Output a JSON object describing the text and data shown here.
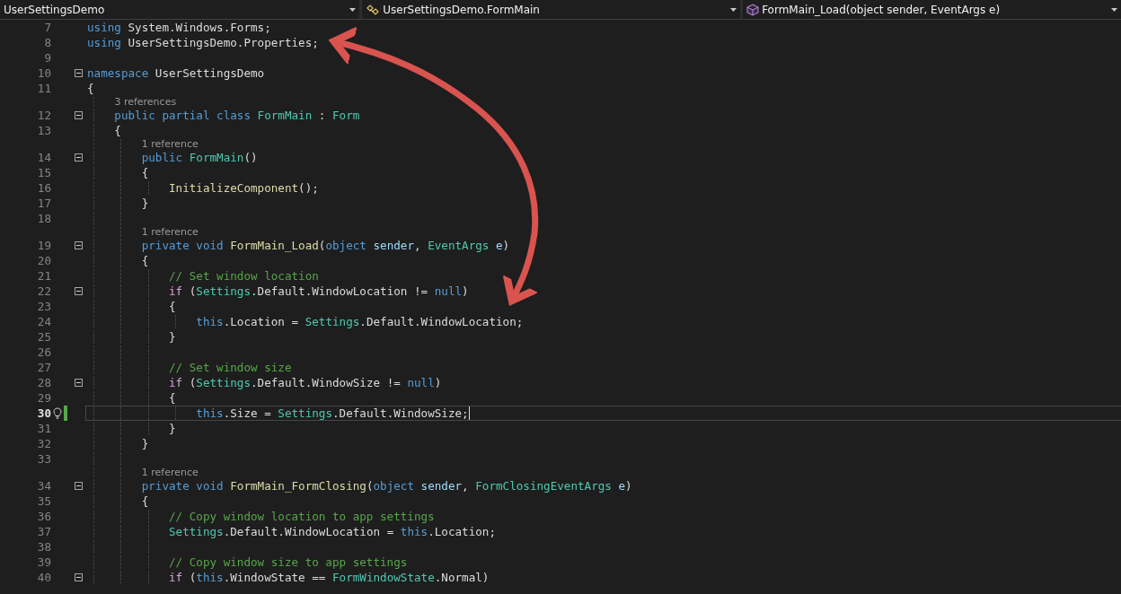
{
  "nav_bar": [
    {
      "label": "UserSettingsDemo",
      "kind": "project"
    },
    {
      "label": "UserSettingsDemo.FormMain",
      "kind": "class"
    },
    {
      "label": "FormMain_Load(object sender, EventArgs e)",
      "kind": "method"
    }
  ],
  "lines": [
    {
      "number": "7",
      "fold": false,
      "current": false,
      "tokens": [
        {
          "kind": "keyword",
          "text": "using"
        },
        {
          "kind": "plain",
          "text": " System.Windows.Forms;"
        }
      ]
    },
    {
      "number": "8",
      "fold": false,
      "current": false,
      "tokens": [
        {
          "kind": "keyword",
          "text": "using"
        },
        {
          "kind": "plain",
          "text": " UserSettingsDemo.Properties;"
        }
      ]
    },
    {
      "number": "9",
      "fold": false,
      "current": false
    },
    {
      "number": "10",
      "fold": true,
      "current": false,
      "tokens": [
        {
          "kind": "keyword",
          "text": "namespace"
        },
        {
          "kind": "plain",
          "text": " UserSettingsDemo"
        }
      ]
    },
    {
      "number": "11",
      "fold": false,
      "current": false,
      "tokens": [
        {
          "kind": "plain",
          "text": "{"
        }
      ]
    },
    {
      "number": "12",
      "fold": true,
      "current": false,
      "lens": "3 references",
      "tokens": [
        {
          "kind": "keyword",
          "text": "    public partial class "
        },
        {
          "kind": "type",
          "text": "FormMain"
        },
        {
          "kind": "plain",
          "text": " : "
        },
        {
          "kind": "type",
          "text": "Form"
        }
      ]
    },
    {
      "number": "13",
      "fold": false,
      "current": false,
      "tokens": [
        {
          "kind": "plain",
          "text": "    {"
        }
      ]
    },
    {
      "number": "14",
      "fold": true,
      "current": false,
      "lens": "1 reference",
      "tokens": [
        {
          "kind": "keyword",
          "text": "        public "
        },
        {
          "kind": "type",
          "text": "FormMain"
        },
        {
          "kind": "plain",
          "text": "()"
        }
      ]
    },
    {
      "number": "15",
      "fold": false,
      "current": false,
      "tokens": [
        {
          "kind": "plain",
          "text": "        {"
        }
      ]
    },
    {
      "number": "16",
      "fold": false,
      "current": false,
      "tokens": [
        {
          "kind": "method",
          "text": "            InitializeComponent"
        },
        {
          "kind": "plain",
          "text": "();"
        }
      ]
    },
    {
      "number": "17",
      "fold": false,
      "current": false,
      "tokens": [
        {
          "kind": "plain",
          "text": "        }"
        }
      ]
    },
    {
      "number": "18",
      "fold": false,
      "current": false
    },
    {
      "number": "19",
      "fold": true,
      "current": false,
      "lens": "1 reference",
      "tokens": [
        {
          "kind": "keyword",
          "text": "        private void "
        },
        {
          "kind": "method",
          "text": "FormMain_Load"
        },
        {
          "kind": "plain",
          "text": "("
        },
        {
          "kind": "keyword",
          "text": "object "
        },
        {
          "kind": "variable",
          "text": "sender"
        },
        {
          "kind": "plain",
          "text": ", "
        },
        {
          "kind": "type",
          "text": "EventArgs"
        },
        {
          "kind": "variable",
          "text": " e"
        },
        {
          "kind": "plain",
          "text": ")"
        }
      ]
    },
    {
      "number": "20",
      "fold": false,
      "current": false,
      "tokens": [
        {
          "kind": "plain",
          "text": "        {"
        }
      ]
    },
    {
      "number": "21",
      "fold": false,
      "current": false,
      "tokens": [
        {
          "kind": "comment",
          "text": "            // Set window location"
        }
      ]
    },
    {
      "number": "22",
      "fold": true,
      "current": false,
      "tokens": [
        {
          "kind": "control",
          "text": "            if"
        },
        {
          "kind": "plain",
          "text": " ("
        },
        {
          "kind": "type",
          "text": "Settings"
        },
        {
          "kind": "plain",
          "text": ".Default.WindowLocation != "
        },
        {
          "kind": "keyword",
          "text": "null"
        },
        {
          "kind": "plain",
          "text": ")"
        }
      ]
    },
    {
      "number": "23",
      "fold": false,
      "current": false,
      "tokens": [
        {
          "kind": "plain",
          "text": "            {"
        }
      ]
    },
    {
      "number": "24",
      "fold": false,
      "current": false,
      "tokens": [
        {
          "kind": "keyword",
          "text": "                this"
        },
        {
          "kind": "plain",
          "text": ".Location = "
        },
        {
          "kind": "type",
          "text": "Settings"
        },
        {
          "kind": "plain",
          "text": ".Default.WindowLocation;"
        }
      ]
    },
    {
      "number": "25",
      "fold": false,
      "current": false,
      "tokens": [
        {
          "kind": "plain",
          "text": "            }"
        }
      ]
    },
    {
      "number": "26",
      "fold": false,
      "current": false
    },
    {
      "number": "27",
      "fold": false,
      "current": false,
      "tokens": [
        {
          "kind": "comment",
          "text": "            // Set window size"
        }
      ]
    },
    {
      "number": "28",
      "fold": true,
      "current": false,
      "tokens": [
        {
          "kind": "control",
          "text": "            if"
        },
        {
          "kind": "plain",
          "text": " ("
        },
        {
          "kind": "type",
          "text": "Settings"
        },
        {
          "kind": "plain",
          "text": ".Default.WindowSize != "
        },
        {
          "kind": "keyword",
          "text": "null"
        },
        {
          "kind": "plain",
          "text": ")"
        }
      ]
    },
    {
      "number": "29",
      "fold": false,
      "current": false,
      "tokens": [
        {
          "kind": "plain",
          "text": "            {"
        }
      ]
    },
    {
      "number": "30",
      "fold": false,
      "current": true,
      "tokens": [
        {
          "kind": "keyword",
          "text": "                this"
        },
        {
          "kind": "plain",
          "text": ".Size = "
        },
        {
          "kind": "type",
          "text": "Settings"
        },
        {
          "kind": "plain",
          "text": ".Default.WindowSize;"
        }
      ]
    },
    {
      "number": "31",
      "fold": false,
      "current": false,
      "tokens": [
        {
          "kind": "plain",
          "text": "            }"
        }
      ]
    },
    {
      "number": "32",
      "fold": false,
      "current": false,
      "tokens": [
        {
          "kind": "plain",
          "text": "        }"
        }
      ]
    },
    {
      "number": "33",
      "fold": false,
      "current": false
    },
    {
      "number": "34",
      "fold": true,
      "current": false,
      "lens": "1 reference",
      "tokens": [
        {
          "kind": "keyword",
          "text": "        private void "
        },
        {
          "kind": "method",
          "text": "FormMain_FormClosing"
        },
        {
          "kind": "plain",
          "text": "("
        },
        {
          "kind": "keyword",
          "text": "object "
        },
        {
          "kind": "variable",
          "text": "sender"
        },
        {
          "kind": "plain",
          "text": ", "
        },
        {
          "kind": "type",
          "text": "FormClosingEventArgs"
        },
        {
          "kind": "variable",
          "text": " e"
        },
        {
          "kind": "plain",
          "text": ")"
        }
      ]
    },
    {
      "number": "35",
      "fold": false,
      "current": false,
      "tokens": [
        {
          "kind": "plain",
          "text": "        {"
        }
      ]
    },
    {
      "number": "36",
      "fold": false,
      "current": false,
      "tokens": [
        {
          "kind": "comment",
          "text": "            // Copy window location to app settings"
        }
      ]
    },
    {
      "number": "37",
      "fold": false,
      "current": false,
      "tokens": [
        {
          "kind": "type",
          "text": "            Settings"
        },
        {
          "kind": "plain",
          "text": ".Default.WindowLocation = "
        },
        {
          "kind": "keyword",
          "text": "this"
        },
        {
          "kind": "plain",
          "text": ".Location;"
        }
      ]
    },
    {
      "number": "38",
      "fold": false,
      "current": false
    },
    {
      "number": "39",
      "fold": false,
      "current": false,
      "tokens": [
        {
          "kind": "comment",
          "text": "            // Copy window size to app settings"
        }
      ]
    },
    {
      "number": "40",
      "fold": true,
      "current": false,
      "tokens": [
        {
          "kind": "control",
          "text": "            if"
        },
        {
          "kind": "plain",
          "text": " ("
        },
        {
          "kind": "keyword",
          "text": "this"
        },
        {
          "kind": "plain",
          "text": ".WindowState == "
        },
        {
          "kind": "type",
          "text": "FormWindowState"
        },
        {
          "kind": "plain",
          "text": ".Normal)"
        }
      ]
    }
  ]
}
